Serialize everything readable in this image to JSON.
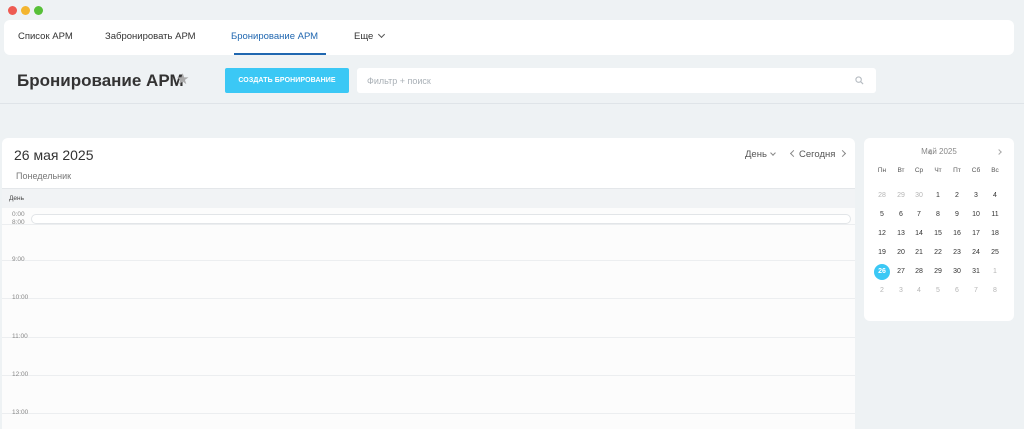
{
  "nav": {
    "items": [
      {
        "label": "Список АРМ",
        "active": false
      },
      {
        "label": "Забронировать АРМ",
        "active": false
      },
      {
        "label": "Бронирование АРМ",
        "active": true
      },
      {
        "label": "Еще",
        "active": false,
        "dropdown": true
      }
    ]
  },
  "header": {
    "title": "Бронирование АРМ",
    "create_button": "СОЗДАТЬ БРОНИРОВАНИЕ",
    "search_placeholder": "Фильтр + поиск",
    "search_value": ""
  },
  "calendar": {
    "date": "26 мая 2025",
    "weekday": "Понедельник",
    "view": "День",
    "today": "Сегодня",
    "strip_label": "День",
    "hours": [
      "0:00",
      "8:00",
      "9:00",
      "10:00",
      "11:00",
      "12:00",
      "13:00"
    ]
  },
  "mini_calendar": {
    "month": "Май 2025",
    "weekdays": [
      "Пн",
      "Вт",
      "Ср",
      "Чт",
      "Пт",
      "Сб",
      "Вс"
    ],
    "weeks": [
      [
        "28",
        "29",
        "30",
        "1",
        "2",
        "3",
        "4"
      ],
      [
        "5",
        "6",
        "7",
        "8",
        "9",
        "10",
        "11"
      ],
      [
        "12",
        "13",
        "14",
        "15",
        "16",
        "17",
        "18"
      ],
      [
        "19",
        "20",
        "21",
        "22",
        "23",
        "24",
        "25"
      ],
      [
        "26",
        "27",
        "28",
        "29",
        "30",
        "31",
        "1"
      ],
      [
        "2",
        "3",
        "4",
        "5",
        "6",
        "7",
        "8"
      ]
    ],
    "selected": "26"
  },
  "colors": {
    "accent": "#3bc8f5",
    "active_tab": "#2067b0",
    "background": "#eef2f4"
  }
}
